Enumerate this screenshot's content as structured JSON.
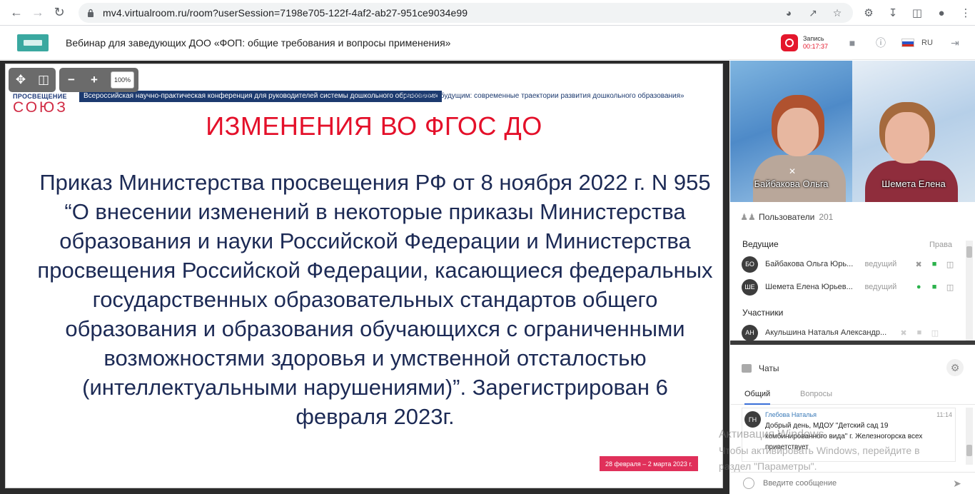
{
  "browser": {
    "url": "mv4.virtualroom.ru/room?userSession=7198e705-122f-4af2-ab27-951ce9034e99"
  },
  "header": {
    "title": "Вебинар для заведующих ДОО «ФОП: общие требования и вопросы применения»",
    "record_label": "Запись",
    "record_time": "00:17:37",
    "language": "RU"
  },
  "toolbar": {
    "zoom": "100%"
  },
  "slide": {
    "logo_top": "ПРОСВЕЩЕНИЕ",
    "logo_main": "СОЮЗ",
    "conference_banner": "Всероссийская научно-практическая конференция для руководителей системы дошкольного образования",
    "conference_quote": "«В союзе с будущим: современные траектории развития дошкольного образования»",
    "title": "ИЗМЕНЕНИЯ ВО ФГОС ДО",
    "body": "Приказ Министерства просвещения РФ от 8 ноября 2022 г. N 955 “О внесении изменений в некоторые приказы Министерства образования и науки Российской Федерации и Министерства просвещения Российской Федерации, касающиеся федеральных государственных образовательных стандартов общего образования и образования обучающихся с ограниченными возможностями здоровья и умственной отсталостью (интеллектуальными нарушениями)”. Зарегистрирован 6 февраля 2023г.",
    "date_tag": "28 февраля – 2 марта 2023 г."
  },
  "videos": [
    {
      "name": "Байбакова Ольга"
    },
    {
      "name": "Шемета Елена"
    }
  ],
  "users": {
    "title": "Пользователи",
    "count": "201",
    "hosts_label": "Ведущие",
    "rights_label": "Права",
    "participants_label": "Участники",
    "hosts": [
      {
        "initials": "БО",
        "name": "Байбакова Ольга Юрь...",
        "role": "ведущий"
      },
      {
        "initials": "ШЕ",
        "name": "Шемета Елена Юрьев...",
        "role": "ведущий"
      }
    ],
    "participants": [
      {
        "initials": "АН",
        "name": "Акульшина Наталья Александр..."
      }
    ]
  },
  "chat": {
    "title": "Чаты",
    "tab_general": "Общий",
    "tab_questions": "Вопросы",
    "message": {
      "initials": "ГН",
      "author": "Глебова Наталья",
      "time": "11:14",
      "text": "Добрый день, МДОУ \"Детский сад 19 комбинированного вида\" г. Железногорска всех приветствует"
    },
    "input_placeholder": "Введите сообщение"
  },
  "watermark": {
    "line1": "Активация Windows",
    "line2": "Чтобы активировать Windows, перейдите в",
    "line3": "раздел \"Параметры\"."
  },
  "colors": {
    "record_red": "#e4172c",
    "slide_title_red": "#e4102a",
    "slide_text_navy": "#1c2a55",
    "mic_green": "#2bb24c"
  }
}
